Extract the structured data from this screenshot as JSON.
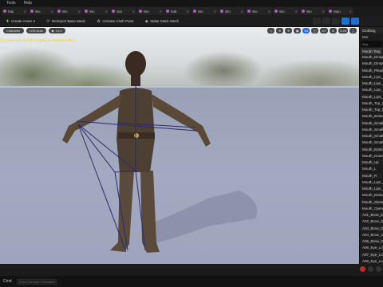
{
  "menubar": {
    "items": [
      "Tools",
      "Help"
    ]
  },
  "tabs": [
    {
      "label": "Mai"
    },
    {
      "label": "Wo"
    },
    {
      "label": "Wo"
    },
    {
      "label": "Wo"
    },
    {
      "label": "Sat"
    },
    {
      "label": "Wo"
    },
    {
      "label": "halt"
    },
    {
      "label": "Wo"
    },
    {
      "label": "Wo"
    },
    {
      "label": "Wo"
    },
    {
      "label": "Wo"
    },
    {
      "label": "Wo"
    },
    {
      "label": "Man"
    }
  ],
  "toolbar": {
    "create_asset": "Create Asset",
    "reimport": "Reimport Base Mesh",
    "activate_cloth": "Activate Cloth Paint",
    "make_static": "Make Static Mesh"
  },
  "viewport": {
    "character_btn": "Character",
    "lod_btn": "LOD Auto",
    "speed_btn": "x1.0",
    "right_controls": [
      "◇",
      "⊕",
      "✣",
      "▣",
      "10",
      "◫",
      "10°",
      "⊡",
      "0.25",
      "▢"
    ],
    "info_line1": "(*) (Used with Morph Targets) in material editor)",
    "info_line2": "Specular: FX_Hair_Specular"
  },
  "right_panel": {
    "title": "Clothing",
    "sub": "Mor",
    "search": "Sea",
    "header": "Morph Targ",
    "items": [
      "Mouth_Dimpl",
      "Mouth_Dimpl",
      "Mouth_Pleas",
      "Mouth_Lips_",
      "Mouth_Lips_",
      "Mouth_Lips_",
      "Mouth_Lips_",
      "Mouth_Top_L",
      "Mouth_Top_L",
      "Mouth_Bottom",
      "Mouth_Small_",
      "Mouth_Small_",
      "Mouth_Small_",
      "Mouth_Small_",
      "Mouth_Bottom",
      "Mouth_Down",
      "Mouth_Up",
      "Mouth_L",
      "Mouth_R",
      "Mouth_Lips_",
      "Mouth_Lips_",
      "Mouth_Bottom",
      "Mouth_Skewe",
      "Mouth_Open",
      "A01_Brow_Do",
      "A02_Brow_Do",
      "A03_Brow_Do",
      "A04_Brow_Ou",
      "A05_Brow_Ou",
      "A06_Eye_Loo",
      "A07_Eye_Loo",
      "A08_Eye_Loo",
      "A09_Eye_Loo"
    ]
  },
  "statusbar": {
    "left": "Cmd",
    "command_placeholder": "Enter Console Command"
  },
  "colors": {
    "accent": "#1f6fd1",
    "record": "#c62828",
    "info_yellow": "#f2d600"
  }
}
